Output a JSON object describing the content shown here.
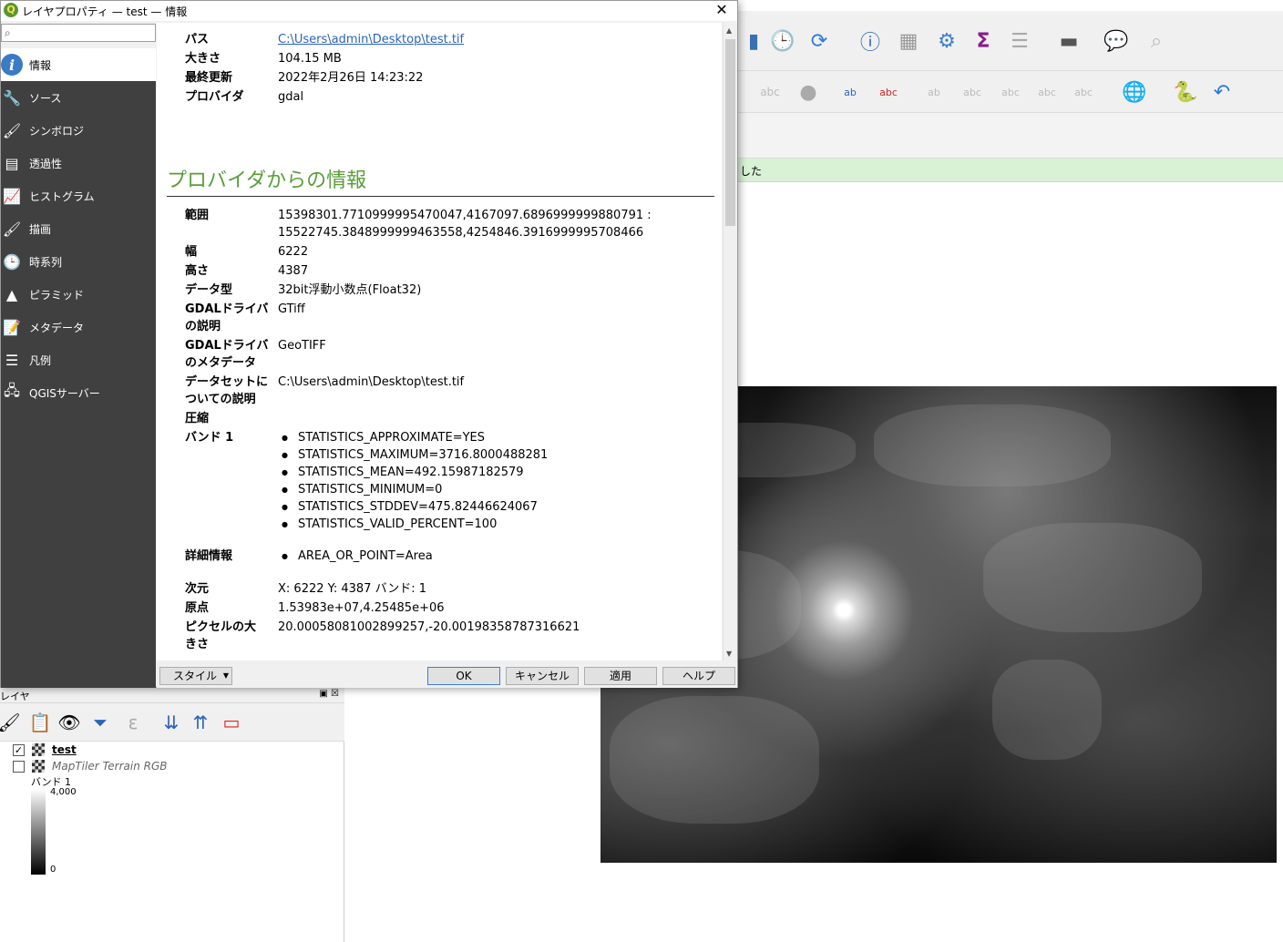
{
  "window": {
    "title": "レイヤプロパティ — test — 情報",
    "logo": "Q"
  },
  "search": {
    "placeholder": ""
  },
  "sidebar": {
    "items": [
      {
        "label": "情報",
        "icon": "info-icon",
        "glyph": "i"
      },
      {
        "label": "ソース",
        "icon": "wrench-icon",
        "glyph": "🔧"
      },
      {
        "label": "シンボロジ",
        "icon": "paintbrush-icon",
        "glyph": "🖌"
      },
      {
        "label": "透過性",
        "icon": "transparency-icon",
        "glyph": "▤"
      },
      {
        "label": "ヒストグラム",
        "icon": "histogram-icon",
        "glyph": "📈"
      },
      {
        "label": "描画",
        "icon": "brush-icon",
        "glyph": "🖌"
      },
      {
        "label": "時系列",
        "icon": "clock-icon",
        "glyph": "🕒"
      },
      {
        "label": "ピラミッド",
        "icon": "pyramid-icon",
        "glyph": "▲"
      },
      {
        "label": "メタデータ",
        "icon": "metadata-icon",
        "glyph": "📝"
      },
      {
        "label": "凡例",
        "icon": "legend-icon",
        "glyph": "☰"
      },
      {
        "label": "QGISサーバー",
        "icon": "server-icon",
        "glyph": "🖧"
      }
    ]
  },
  "info": {
    "general": [
      {
        "label": "パス",
        "value": "C:\\Users\\admin\\Desktop\\test.tif",
        "link": true
      },
      {
        "label": "大きさ",
        "value": "104.15 MB"
      },
      {
        "label": "最終更新",
        "value": "2022年2月26日 14:23:22"
      },
      {
        "label": "プロバイダ",
        "value": "gdal"
      }
    ],
    "provider_section_title": "プロバイダからの情報",
    "extent_label": "範囲",
    "extent_line1": "15398301.7710999995470047,4167097.6896999999880791 :",
    "extent_line2": "15522745.3848999999463558,4254846.3916999995708466",
    "width_label": "幅",
    "width_value": "6222",
    "height_label": "高さ",
    "height_value": "4387",
    "datatype_label": "データ型",
    "datatype_value": "32bit浮動小数点(Float32)",
    "gdal_desc_label1": "GDALドライバ",
    "gdal_desc_label2": "の説明",
    "gdal_desc_value": "GTiff",
    "gdal_meta_label1": "GDALドライバ",
    "gdal_meta_label2": "のメタデータ",
    "gdal_meta_value": "GeoTIFF",
    "dataset_label1": "データセットに",
    "dataset_label2": "ついての説明",
    "dataset_value": "C:\\Users\\admin\\Desktop\\test.tif",
    "compression_label": "圧縮",
    "band_label": "バンド 1",
    "band_stats": [
      "STATISTICS_APPROXIMATE=YES",
      "STATISTICS_MAXIMUM=3716.8000488281",
      "STATISTICS_MEAN=492.15987182579",
      "STATISTICS_MINIMUM=0",
      "STATISTICS_STDDEV=475.82446624067",
      "STATISTICS_VALID_PERCENT=100"
    ],
    "detail_label": "詳細情報",
    "detail_value": "AREA_OR_POINT=Area",
    "dimension_label": "次元",
    "dimension_value": "X: 6222 Y: 4387 バンド: 1",
    "origin_label": "原点",
    "origin_value": "1.53983e+07,4.25485e+06",
    "pixel_label1": "ピクセルの大",
    "pixel_label2": "きさ",
    "pixel_value": "20.00058081002899257,-20.00198358787316621"
  },
  "buttons": {
    "style": "スタイル",
    "ok": "OK",
    "cancel": "キャンセル",
    "apply": "適用",
    "help": "ヘルプ"
  },
  "main": {
    "message_text": "した",
    "toolbar_icons": [
      "bookmark-icon",
      "clock-icon",
      "refresh-icon",
      "identify-icon",
      "attribute-table-icon",
      "settings-icon",
      "sum-icon",
      "table-icon",
      "measure-icon",
      "tooltip-icon",
      "search-icon"
    ]
  },
  "layers": {
    "panel_title": "レイヤ",
    "items": [
      {
        "name": "test",
        "checked": "✓"
      },
      {
        "name": "MapTiler Terrain RGB",
        "checked": ""
      }
    ],
    "legend_band": "バンド 1",
    "legend_max": "4,000",
    "legend_min": "0"
  },
  "colors": {
    "section_title": "#5a9e3b",
    "link": "#2a64b8",
    "sidebar_bg": "#404040",
    "message_bar": "#d9f2d5"
  }
}
